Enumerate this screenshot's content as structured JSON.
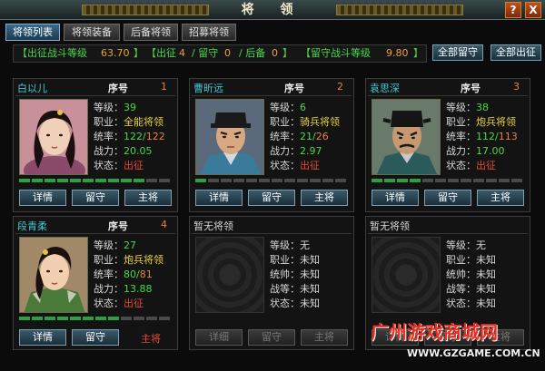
{
  "window": {
    "title": "将 领",
    "help": "?",
    "close": "X"
  },
  "tabs": [
    "将领列表",
    "将领装备",
    "后备将领",
    "招募将领"
  ],
  "infobar": {
    "avg_label": "【出征战斗等级",
    "avg_value": "63.70",
    "avg_end": "】",
    "counts_label1": "【出征",
    "counts_v1": "4",
    "counts_label2": "/ 留守",
    "counts_v2": "0",
    "counts_label3": "/ 后备",
    "counts_v3": "0",
    "counts_end": "】",
    "stay_label": "【留守战斗等级",
    "stay_value": "9.80",
    "stay_end": "】"
  },
  "buttons": {
    "all_stay": "全部留守",
    "all_out": "全部出征"
  },
  "stat_labels": {
    "level": "等级：",
    "job": "职业：",
    "lead": "统率：",
    "lead2": "统帅：",
    "power": "战力：",
    "power2": "战等：",
    "state": "状态："
  },
  "seq_label": "序号",
  "generals": [
    {
      "name": "白以儿",
      "seq": "1",
      "level": "39",
      "job": "全能将领",
      "lead_cur": "122",
      "lead_max": "122",
      "power": "20.05",
      "state": "出征",
      "bars_on": 10,
      "bar_colors": [
        "#e8a0a0",
        "#f0c0b0"
      ],
      "btns": [
        "详情",
        "留守",
        "主将"
      ]
    },
    {
      "name": "曹昕远",
      "seq": "2",
      "level": "6",
      "job": "骑兵将领",
      "lead_cur": "21",
      "lead_max": "26",
      "power": "2.97",
      "state": "出征",
      "bars_on": 1,
      "btns": [
        "详情",
        "留守",
        "主将"
      ]
    },
    {
      "name": "袁思深",
      "seq": "3",
      "level": "38",
      "job": "炮兵将领",
      "lead_cur": "112",
      "lead_max": "113",
      "power": "17.00",
      "state": "出征",
      "bars_on": 4,
      "btns": [
        "详情",
        "留守",
        "主将"
      ]
    },
    {
      "name": "段青柔",
      "seq": "4",
      "level": "27",
      "job": "炮兵将领",
      "lead_cur": "80",
      "lead_max": "81",
      "power": "13.88",
      "state": "出征",
      "bars_on": 8,
      "btns": [
        "详情",
        "留守"
      ],
      "main_label": "主将"
    }
  ],
  "empty_slots": [
    {
      "name": "暂无将领",
      "level": "无",
      "job": "未知",
      "lead": "未知",
      "power": "未知",
      "state": "未知",
      "btns": [
        "详细",
        "留守",
        "主将"
      ]
    },
    {
      "name": "暂无将领",
      "level": "无",
      "job": "未知",
      "lead": "未知",
      "power": "未知",
      "state": "未知",
      "btns": [
        "详情",
        "留守",
        "主将"
      ]
    }
  ],
  "watermark": {
    "line1": "广州游戏商城网",
    "line2": "WWW.GZGAME.COM.CN"
  }
}
